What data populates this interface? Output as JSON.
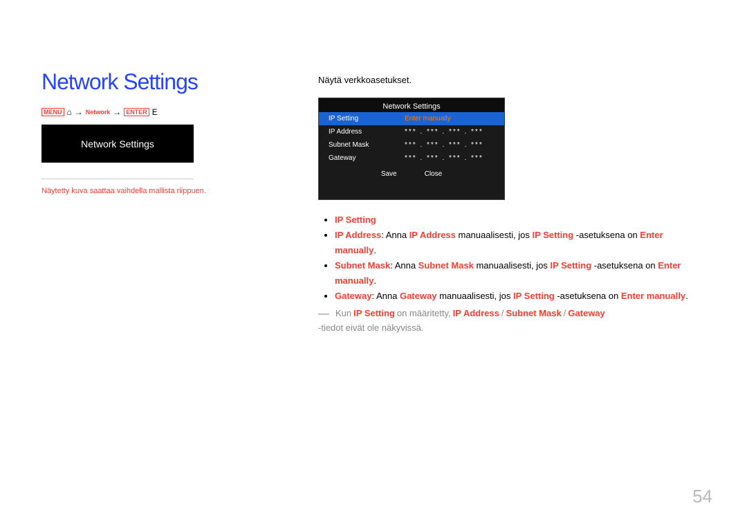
{
  "title": "Network Settings",
  "nav": {
    "menu_icon": "MENU",
    "home_icon": "⌂",
    "arrow": "→",
    "label_icon": "Network",
    "enter_icon": "ENTER",
    "e": "E"
  },
  "menu_box_label": "Network Settings",
  "disclaimer": "Näytetty kuva saattaa vaihdella mallista riippuen.",
  "intro": "Näytä verkkoasetukset.",
  "panel": {
    "title": "Network Settings",
    "ip_setting_label": "IP Setting",
    "ip_setting_value": "Enter manually",
    "rows": [
      {
        "label": "IP Address",
        "value": "*** . *** . *** . ***"
      },
      {
        "label": "Subnet Mask",
        "value": "*** . *** . *** . ***"
      },
      {
        "label": "Gateway",
        "value": "*** . *** . *** . ***"
      }
    ],
    "save": "Save",
    "close": "Close"
  },
  "bullets": {
    "b1": {
      "prefix": "IP Setting",
      "rest": ""
    },
    "b2": {
      "label": "IP Address",
      "pre": ": Anna ",
      "mid_red": "IP Address",
      "post": " manuaalisesti, jos ",
      "post_red": "IP Setting",
      "tail": " -asetuksena on ",
      "tail_red": "Enter manually",
      "end": "."
    },
    "b3": {
      "label": "Subnet Mask",
      "pre": ": Anna ",
      "mid_red": "Subnet Mask",
      "post": " manuaalisesti, jos ",
      "post_red": "IP Setting",
      "tail": " -asetuksena on ",
      "tail_red": "Enter manually",
      "end": "."
    },
    "b4": {
      "label": "Gateway",
      "pre": ": Anna ",
      "mid_red": "Gateway",
      "post": " manuaalisesti, jos ",
      "post_red": "IP Setting",
      "tail": " -asetuksena on ",
      "tail_red": "Enter manually",
      "end": "."
    }
  },
  "note": {
    "dash": "―",
    "pre": "Kun ",
    "r1": "IP Setting",
    "mid1": " on määritetty, ",
    "r2": "IP Address",
    "sep": " / ",
    "r3": "Subnet Mask",
    "sep2": " / ",
    "r4": "Gateway",
    "tail": " -tiedot eivät ole näkyvissä."
  },
  "page_number": "54"
}
